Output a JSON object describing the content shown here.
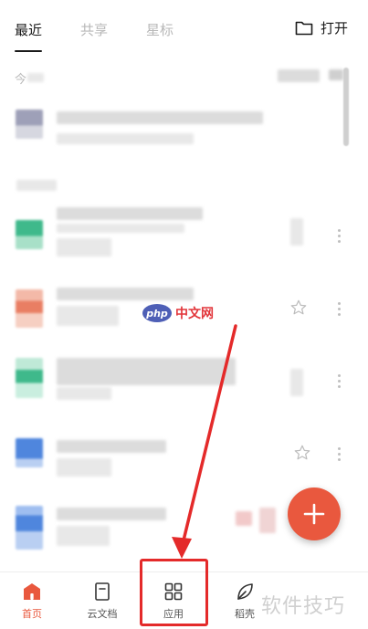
{
  "tabs": [
    {
      "label": "最近",
      "active": true
    },
    {
      "label": "共享",
      "active": false
    },
    {
      "label": "星标",
      "active": false
    }
  ],
  "open_button": {
    "label": "打开",
    "icon": "folder-icon"
  },
  "section_header": {
    "label": "今"
  },
  "watermark": {
    "logo": "php",
    "text": "中文网"
  },
  "fab": {
    "icon": "plus-icon",
    "color": "#e9583e"
  },
  "bottom_nav": [
    {
      "label": "首页",
      "icon": "home-icon",
      "active": true
    },
    {
      "label": "云文档",
      "icon": "document-icon",
      "active": false
    },
    {
      "label": "应用",
      "icon": "grid-apps-icon",
      "active": false,
      "highlighted": true
    },
    {
      "label": "稻壳",
      "icon": "leaf-icon",
      "active": false
    }
  ],
  "brand_watermark": "软件技巧",
  "colors": {
    "accent": "#e9583e",
    "highlight": "#e42a2a"
  }
}
